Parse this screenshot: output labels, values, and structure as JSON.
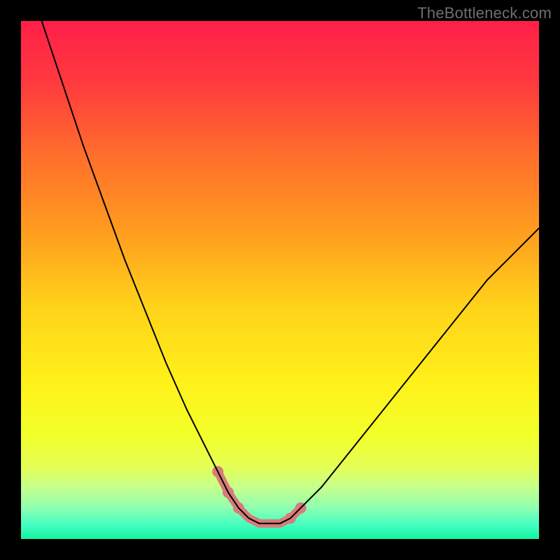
{
  "watermark": "TheBottleneck.com",
  "chart_data": {
    "type": "line",
    "title": "",
    "xlabel": "",
    "ylabel": "",
    "xlim": [
      0,
      100
    ],
    "ylim": [
      0,
      100
    ],
    "grid": false,
    "legend": false,
    "background_gradient": {
      "stops": [
        {
          "offset": 0.0,
          "color": "#ff1f49"
        },
        {
          "offset": 0.12,
          "color": "#ff3a3e"
        },
        {
          "offset": 0.25,
          "color": "#ff6b2d"
        },
        {
          "offset": 0.4,
          "color": "#ff9a1f"
        },
        {
          "offset": 0.55,
          "color": "#ffd21a"
        },
        {
          "offset": 0.7,
          "color": "#fff11a"
        },
        {
          "offset": 0.8,
          "color": "#f3ff2a"
        },
        {
          "offset": 0.86,
          "color": "#e4ff55"
        },
        {
          "offset": 0.9,
          "color": "#c6ff8c"
        },
        {
          "offset": 0.94,
          "color": "#8effb0"
        },
        {
          "offset": 0.97,
          "color": "#4affc2"
        },
        {
          "offset": 1.0,
          "color": "#11f59f"
        }
      ]
    },
    "series": [
      {
        "name": "curve",
        "color": "#000000",
        "width": 2,
        "x": [
          4,
          8,
          12,
          16,
          20,
          24,
          28,
          32,
          36,
          38,
          40,
          42,
          44,
          46,
          48,
          50,
          52,
          54,
          58,
          62,
          66,
          70,
          74,
          78,
          82,
          86,
          90,
          94,
          98,
          100
        ],
        "y": [
          100,
          88,
          76,
          65,
          54,
          44,
          34,
          25,
          17,
          13,
          9,
          6,
          4,
          3,
          3,
          3,
          4,
          6,
          10,
          15,
          20,
          25,
          30,
          35,
          40,
          45,
          50,
          54,
          58,
          60
        ]
      },
      {
        "name": "highlight",
        "color": "#d77b7b",
        "width": 12,
        "linecap": "round",
        "x": [
          38,
          40,
          42,
          44,
          46,
          48,
          50,
          52,
          54
        ],
        "y": [
          13,
          9,
          6,
          4,
          3,
          3,
          3,
          4,
          6
        ]
      }
    ],
    "highlight_dots": {
      "color": "#d77b7b",
      "radius": 8,
      "points": [
        {
          "x": 38,
          "y": 13
        },
        {
          "x": 40,
          "y": 9
        },
        {
          "x": 42,
          "y": 6
        },
        {
          "x": 52,
          "y": 4
        },
        {
          "x": 54,
          "y": 6
        }
      ]
    }
  }
}
